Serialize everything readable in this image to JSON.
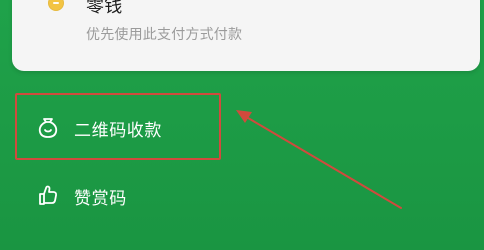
{
  "wallet_card": {
    "title": "零钱",
    "subtitle": "优先使用此支付方式付款",
    "icon": "coin-icon"
  },
  "menu": {
    "items": [
      {
        "label": "二维码收款",
        "icon": "money-bag-icon"
      },
      {
        "label": "赞赏码",
        "icon": "thumbs-up-icon"
      }
    ]
  },
  "colors": {
    "background": "#1d9c46",
    "card": "#f5f5f5",
    "annotation": "#d14a3d",
    "coin": "#f3c443"
  }
}
